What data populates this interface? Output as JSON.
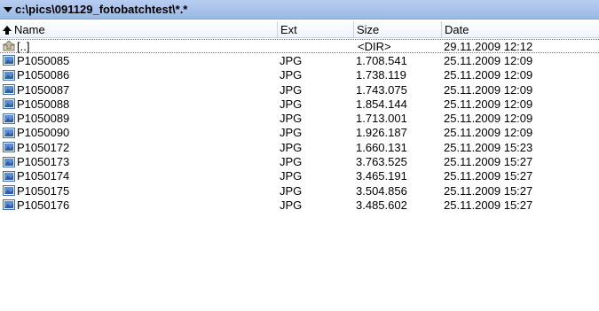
{
  "path_bar": {
    "path": "c:\\pics\\091129_fotobatchtest\\*.*"
  },
  "columns": {
    "name": "Name",
    "ext": "Ext",
    "size": "Size",
    "date": "Date"
  },
  "parent_row": {
    "name": "[..]",
    "ext": "",
    "size": "<DIR>",
    "date": "29.11.2009 12:12"
  },
  "files": [
    {
      "name": "P1050085",
      "ext": "JPG",
      "size": "1.708.541",
      "date": "25.11.2009 12:09"
    },
    {
      "name": "P1050086",
      "ext": "JPG",
      "size": "1.738.119",
      "date": "25.11.2009 12:09"
    },
    {
      "name": "P1050087",
      "ext": "JPG",
      "size": "1.743.075",
      "date": "25.11.2009 12:09"
    },
    {
      "name": "P1050088",
      "ext": "JPG",
      "size": "1.854.144",
      "date": "25.11.2009 12:09"
    },
    {
      "name": "P1050089",
      "ext": "JPG",
      "size": "1.713.001",
      "date": "25.11.2009 12:09"
    },
    {
      "name": "P1050090",
      "ext": "JPG",
      "size": "1.926.187",
      "date": "25.11.2009 12:09"
    },
    {
      "name": "P1050172",
      "ext": "JPG",
      "size": "1.660.131",
      "date": "25.11.2009 15:23"
    },
    {
      "name": "P1050173",
      "ext": "JPG",
      "size": "3.763.525",
      "date": "25.11.2009 15:27"
    },
    {
      "name": "P1050174",
      "ext": "JPG",
      "size": "3.465.191",
      "date": "25.11.2009 15:27"
    },
    {
      "name": "P1050175",
      "ext": "JPG",
      "size": "3.504.856",
      "date": "25.11.2009 15:27"
    },
    {
      "name": "P1050176",
      "ext": "JPG",
      "size": "3.485.602",
      "date": "25.11.2009 15:27"
    }
  ],
  "icons": {
    "path_dropdown": "chevron-down-icon",
    "sort": "sort-up-arrow-icon",
    "parent": "up-folder-icon",
    "file": "image-file-icon"
  },
  "colors": {
    "path_bar": "#9db9e8",
    "highlight_underline": "#f26a35"
  }
}
